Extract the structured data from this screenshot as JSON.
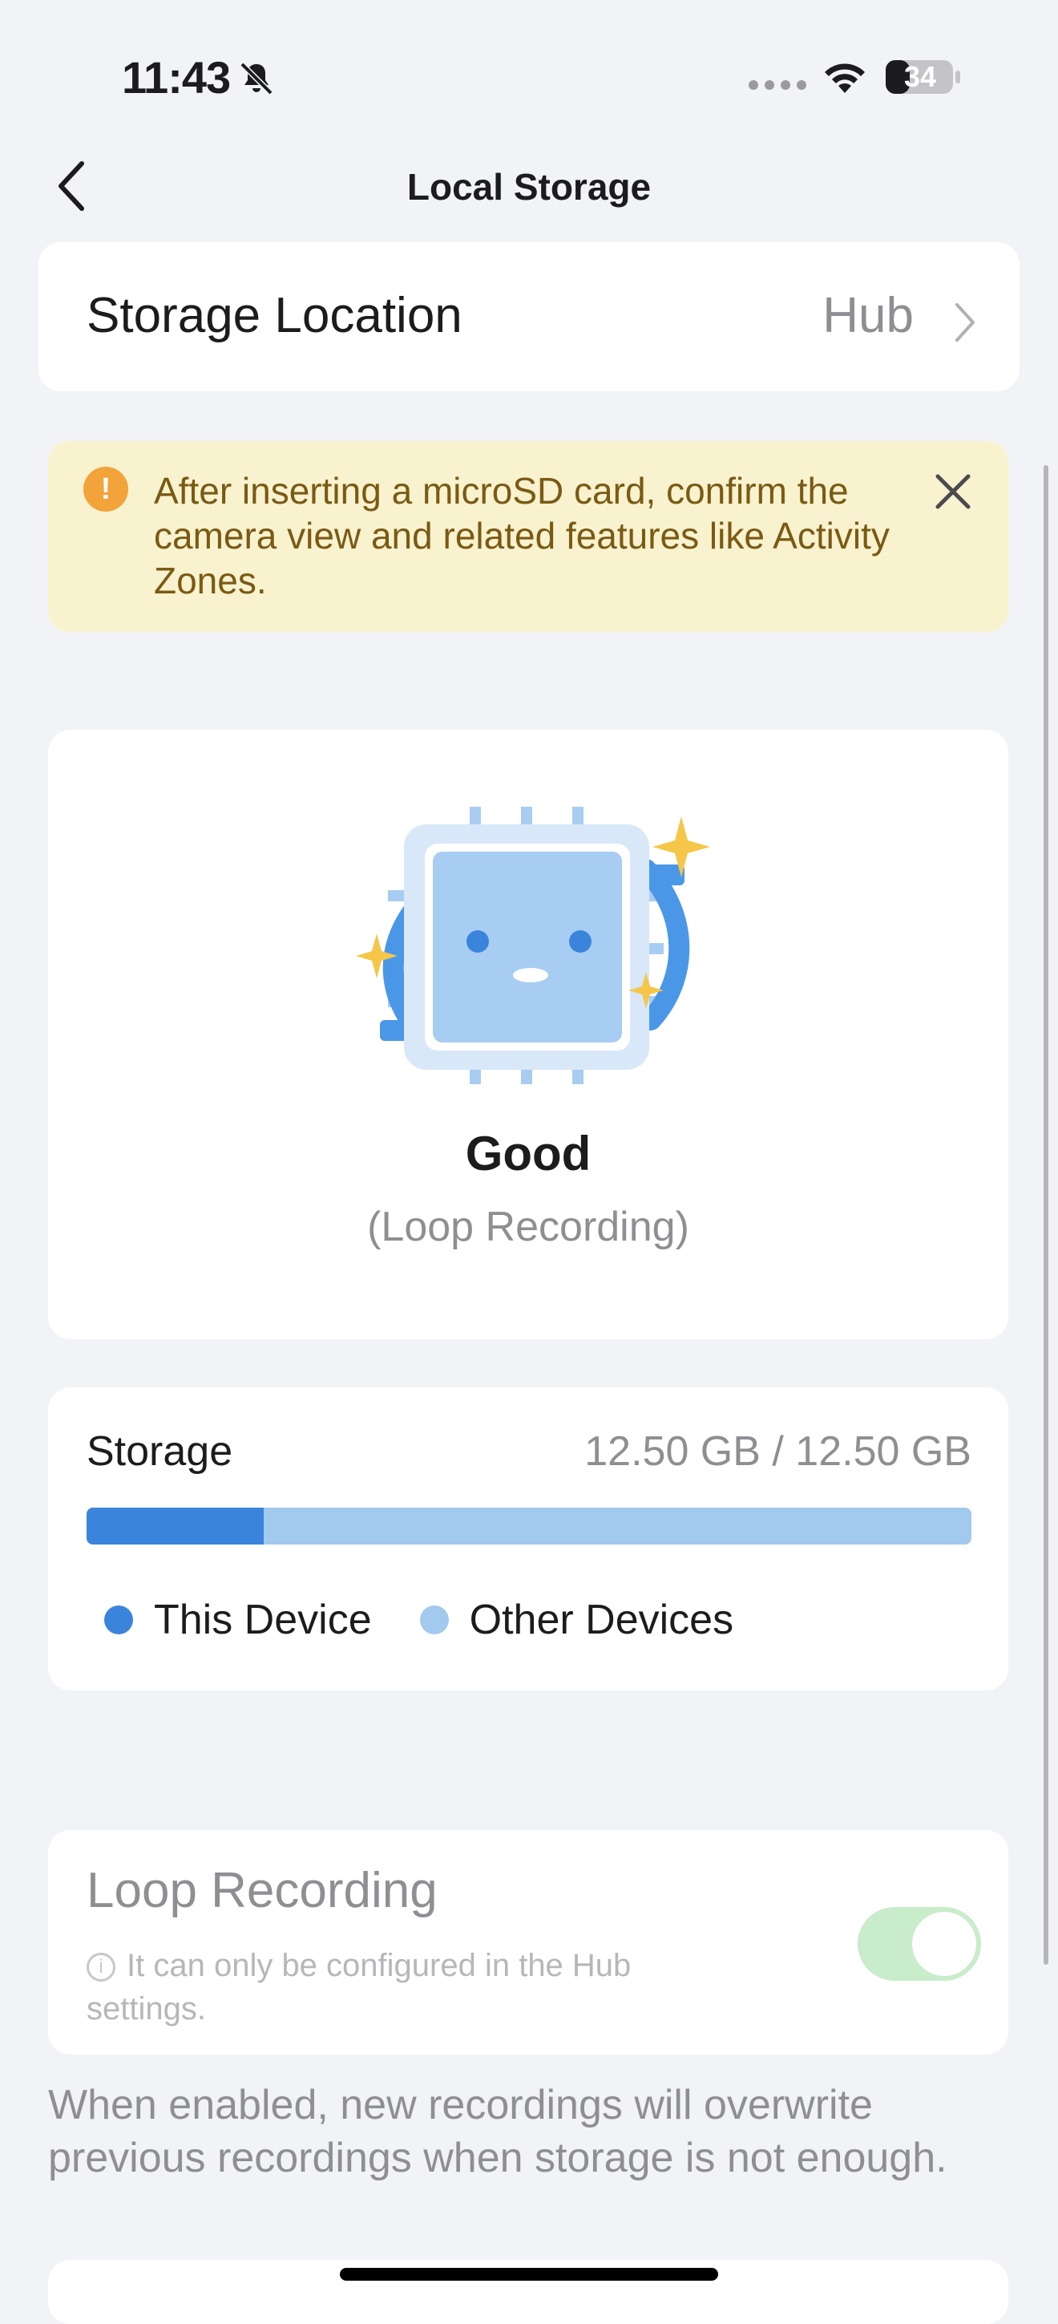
{
  "status_bar": {
    "time": "11:43",
    "battery": "34"
  },
  "nav": {
    "title": "Local Storage"
  },
  "storage_location": {
    "label": "Storage Location",
    "value": "Hub"
  },
  "warning": {
    "text": "After inserting a microSD card, confirm the camera view and related features like Activity Zones."
  },
  "status": {
    "title": "Good",
    "subtitle": "(Loop Recording)"
  },
  "storage": {
    "label": "Storage",
    "value": "12.50 GB / 12.50 GB",
    "this_device_fraction": 0.2,
    "legend": [
      {
        "label": "This Device",
        "color": "#3b84dc"
      },
      {
        "label": "Other Devices",
        "color": "#a2c9ee"
      }
    ]
  },
  "loop_recording": {
    "title": "Loop Recording",
    "info": "It can only be configured in the Hub settings.",
    "enabled": true,
    "description": "When enabled, new recordings will overwrite previous recordings when storage is not enough."
  },
  "colors": {
    "accent": "#3b84dc",
    "warning_bg": "#f9f2cf",
    "warning_icon": "#f2a33a"
  }
}
